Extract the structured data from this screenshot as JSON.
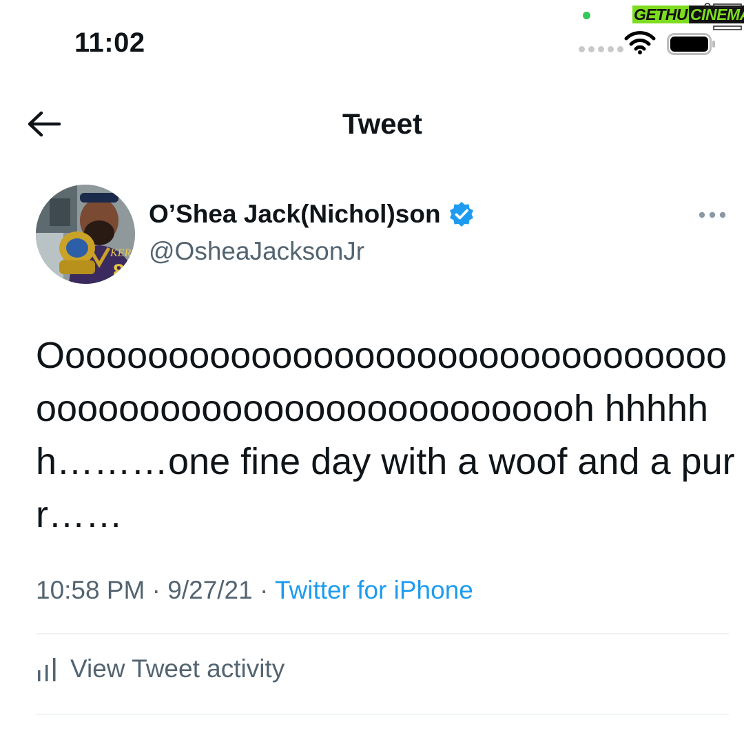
{
  "status_bar": {
    "time": "11:02"
  },
  "watermark": {
    "part1": "GETHU",
    "part2": "CINEMA"
  },
  "nav": {
    "title": "Tweet"
  },
  "tweet": {
    "author": {
      "display_name": "O’Shea Jack(Nichol)son",
      "handle": "@OsheaJacksonJr",
      "verified": true
    },
    "text": "Oooooooooooooooooooooooooooooooooooooooooooooooooooooooooooh hhhhhh………one fine day with a woof and a purr……",
    "time": "10:58 PM",
    "separator": "·",
    "date": "9/27/21",
    "source": "Twitter for iPhone"
  },
  "actions": {
    "view_activity_label": "View Tweet activity"
  },
  "colors": {
    "accent": "#1d9bf0",
    "secondary_text": "#536471",
    "primary_text": "#0f1419",
    "divider": "#eff3f4",
    "watermark_green": "#7ddc1f"
  },
  "icons": [
    "back-arrow-icon",
    "verified-badge-icon",
    "more-icon",
    "bar-chart-icon",
    "wifi-icon",
    "battery-icon"
  ]
}
